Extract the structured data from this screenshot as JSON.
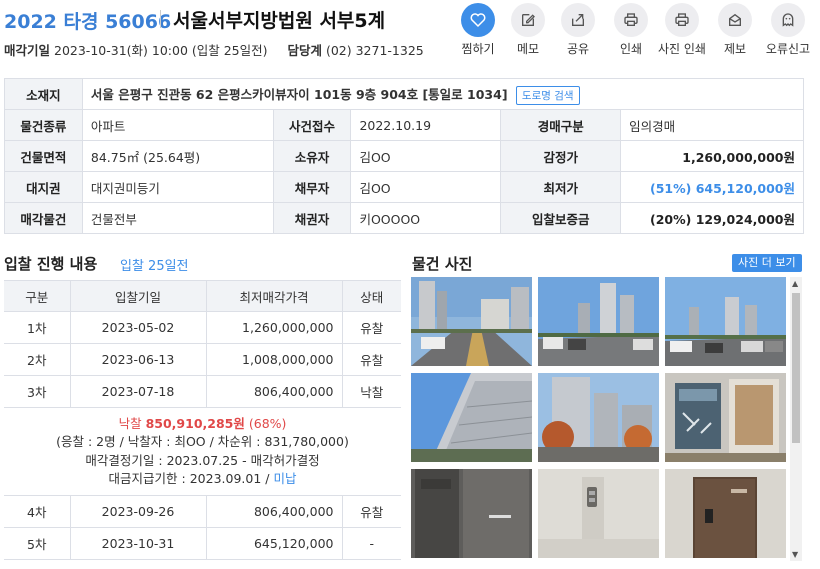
{
  "header": {
    "case_no": "2022 타경 56066",
    "court": "서울서부지방법원 서부5계",
    "sale_date_label": "매각기일",
    "sale_date_value": "2023-10-31(화) 10:00 (입찰 25일전)",
    "dept_label": "담당계",
    "dept_phone": "(02) 3271-1325"
  },
  "actions": [
    {
      "label": "찜하기",
      "icon": "heart-icon"
    },
    {
      "label": "메모",
      "icon": "memo-icon"
    },
    {
      "label": "공유",
      "icon": "share-icon"
    },
    {
      "label": "인쇄",
      "icon": "print-icon"
    },
    {
      "label": "사진 인쇄",
      "icon": "print-icon"
    },
    {
      "label": "제보",
      "icon": "mail-icon"
    },
    {
      "label": "오류신고",
      "icon": "ghost-icon"
    }
  ],
  "info": {
    "address_label": "소재지",
    "address": "서울 은평구 진관동 62 은평스카이뷰자이 101동 9층 904호 [통일로 1034]",
    "road_search": "도로명 검색",
    "rows": [
      [
        {
          "h": "물건종류"
        },
        {
          "v": "아파트"
        },
        {
          "h": "사건접수"
        },
        {
          "v": "2022.10.19"
        },
        {
          "h": "경매구분"
        },
        {
          "v": "임의경매"
        }
      ],
      [
        {
          "h": "건물면적"
        },
        {
          "v": "84.75㎡ (25.64평)"
        },
        {
          "h": "소유자"
        },
        {
          "v": "김OO"
        },
        {
          "h": "감정가"
        },
        {
          "r": "1,260,000,000원"
        }
      ],
      [
        {
          "h": "대지권"
        },
        {
          "v": "대지권미등기"
        },
        {
          "h": "채무자"
        },
        {
          "v": "김OO"
        },
        {
          "h": "최저가"
        },
        {
          "rb": "(51%) 645,120,000원"
        }
      ],
      [
        {
          "h": "매각물건"
        },
        {
          "v": "건물전부"
        },
        {
          "h": "채권자"
        },
        {
          "v": "키OOOOO"
        },
        {
          "h": "입찰보증금"
        },
        {
          "r": "(20%) 129,024,000원"
        }
      ]
    ]
  },
  "bidding": {
    "title": "입찰 진행 내용",
    "sub": "입찰 25일전",
    "headers": [
      "구분",
      "입찰기일",
      "최저매각가격",
      "상태"
    ],
    "rows_before": [
      [
        "1차",
        "2023-05-02",
        "1,260,000,000",
        "유찰"
      ],
      [
        "2차",
        "2023-06-13",
        "1,008,000,000",
        "유찰"
      ],
      [
        "3차",
        "2023-07-18",
        "806,400,000",
        "낙찰"
      ]
    ],
    "detail": {
      "sold_label": "낙찰",
      "sold_price": "850,910,285원",
      "sold_rate": "(68%)",
      "line2": "(응찰 : 2명 / 낙찰자 : 최OO / 차순위 : 831,780,000)",
      "line3": "매각결정기일 : 2023.07.25 - 매각허가결정",
      "line4_prefix": "대금지급기한 : 2023.09.01 / ",
      "line4_status": "미납"
    },
    "rows_after": [
      [
        "4차",
        "2023-09-26",
        "806,400,000",
        "유찰"
      ],
      [
        "5차",
        "2023-10-31",
        "645,120,000",
        "-"
      ]
    ]
  },
  "photos": {
    "title": "물건 사진",
    "more": "사진 더 보기"
  }
}
